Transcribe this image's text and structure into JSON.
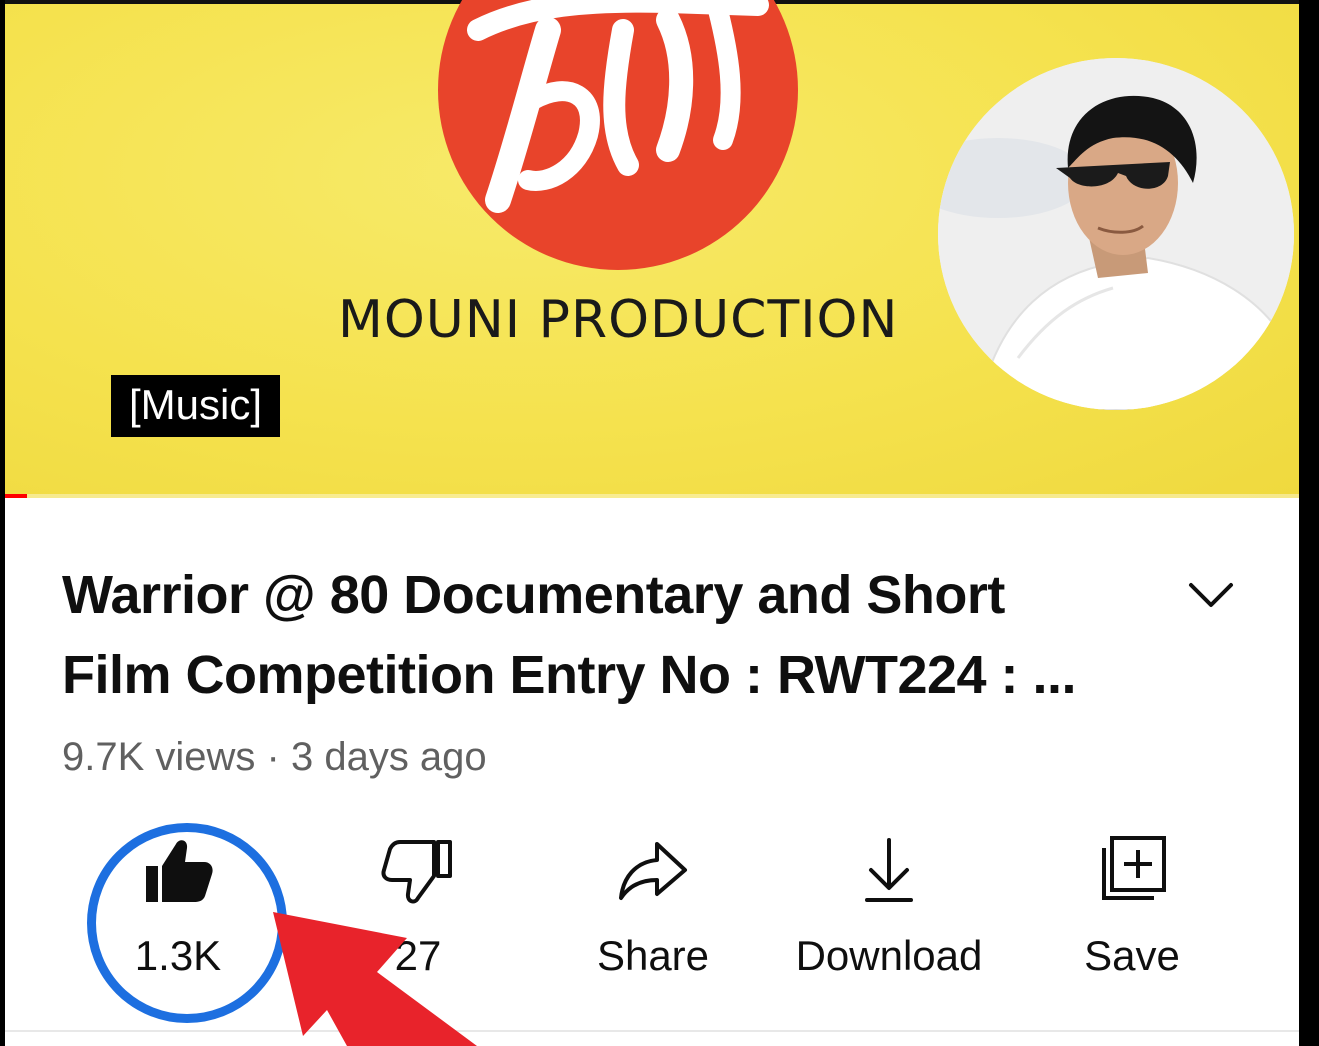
{
  "player": {
    "brand_text": "MOUNI PRODUCTION",
    "caption": "[Music]",
    "progress_fraction": 0.017,
    "colors": {
      "background": "#f5e24e",
      "logo": "#e8442b",
      "progress": "#ff0000"
    }
  },
  "video": {
    "title_line1": "Warrior @ 80 Documentary and Short",
    "title_line2": "Film Competition Entry No : RWT224 : ...",
    "views": "9.7K views",
    "separator": " · ",
    "uploaded": "3 days ago"
  },
  "actions": {
    "like": {
      "icon": "thumbs-up-filled-icon",
      "label": "1.3K"
    },
    "dislike": {
      "icon": "thumbs-down-icon",
      "label": "27"
    },
    "share": {
      "icon": "share-arrow-icon",
      "label": "Share"
    },
    "download": {
      "icon": "download-icon",
      "label": "Download"
    },
    "save": {
      "icon": "save-to-playlist-icon",
      "label": "Save"
    }
  },
  "annotation": {
    "ring_color": "#1d6fe0",
    "arrow_color": "#e8232b"
  }
}
